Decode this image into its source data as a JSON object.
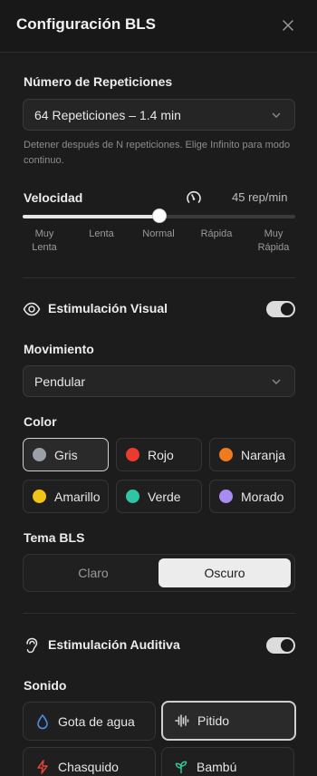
{
  "header": {
    "title": "Configuración BLS",
    "close_icon": "close-icon"
  },
  "repeticiones": {
    "label": "Número de Repeticiones",
    "selected": "64 Repeticiones – 1.4 min",
    "help": "Detener después de N repeticiones. Elige Infinito para modo continuo."
  },
  "velocidad": {
    "label": "Velocidad",
    "value_text": "45 rep/min",
    "level_fraction": 0.5,
    "ticks": [
      "Muy\nLenta",
      "Lenta",
      "Normal",
      "Rápida",
      "Muy\nRápida"
    ]
  },
  "visual": {
    "label": "Estimulación Visual",
    "enabled": true,
    "movimiento_label": "Movimiento",
    "movimiento_selected": "Pendular",
    "color_label": "Color",
    "colors": [
      {
        "name": "Gris",
        "hex": "#9aa0a8",
        "selected": true
      },
      {
        "name": "Rojo",
        "hex": "#ea3b2e",
        "selected": false
      },
      {
        "name": "Naranja",
        "hex": "#f07b1f",
        "selected": false
      },
      {
        "name": "Amarillo",
        "hex": "#f2c418",
        "selected": false
      },
      {
        "name": "Verde",
        "hex": "#2fc4a4",
        "selected": false
      },
      {
        "name": "Morado",
        "hex": "#a98cf0",
        "selected": false
      }
    ],
    "tema_label": "Tema BLS",
    "tema_options": [
      "Claro",
      "Oscuro"
    ],
    "tema_selected": "Oscuro"
  },
  "auditiva": {
    "label": "Estimulación Auditiva",
    "enabled": true,
    "sonido_label": "Sonido",
    "sonidos": [
      {
        "name": "Gota de agua",
        "icon": "water-drop-icon",
        "selected": false
      },
      {
        "name": "Pitido",
        "icon": "waveform-icon",
        "selected": true
      },
      {
        "name": "Chasquido",
        "icon": "lightning-icon",
        "selected": false
      },
      {
        "name": "Bambú",
        "icon": "sprout-icon",
        "selected": false
      }
    ]
  }
}
